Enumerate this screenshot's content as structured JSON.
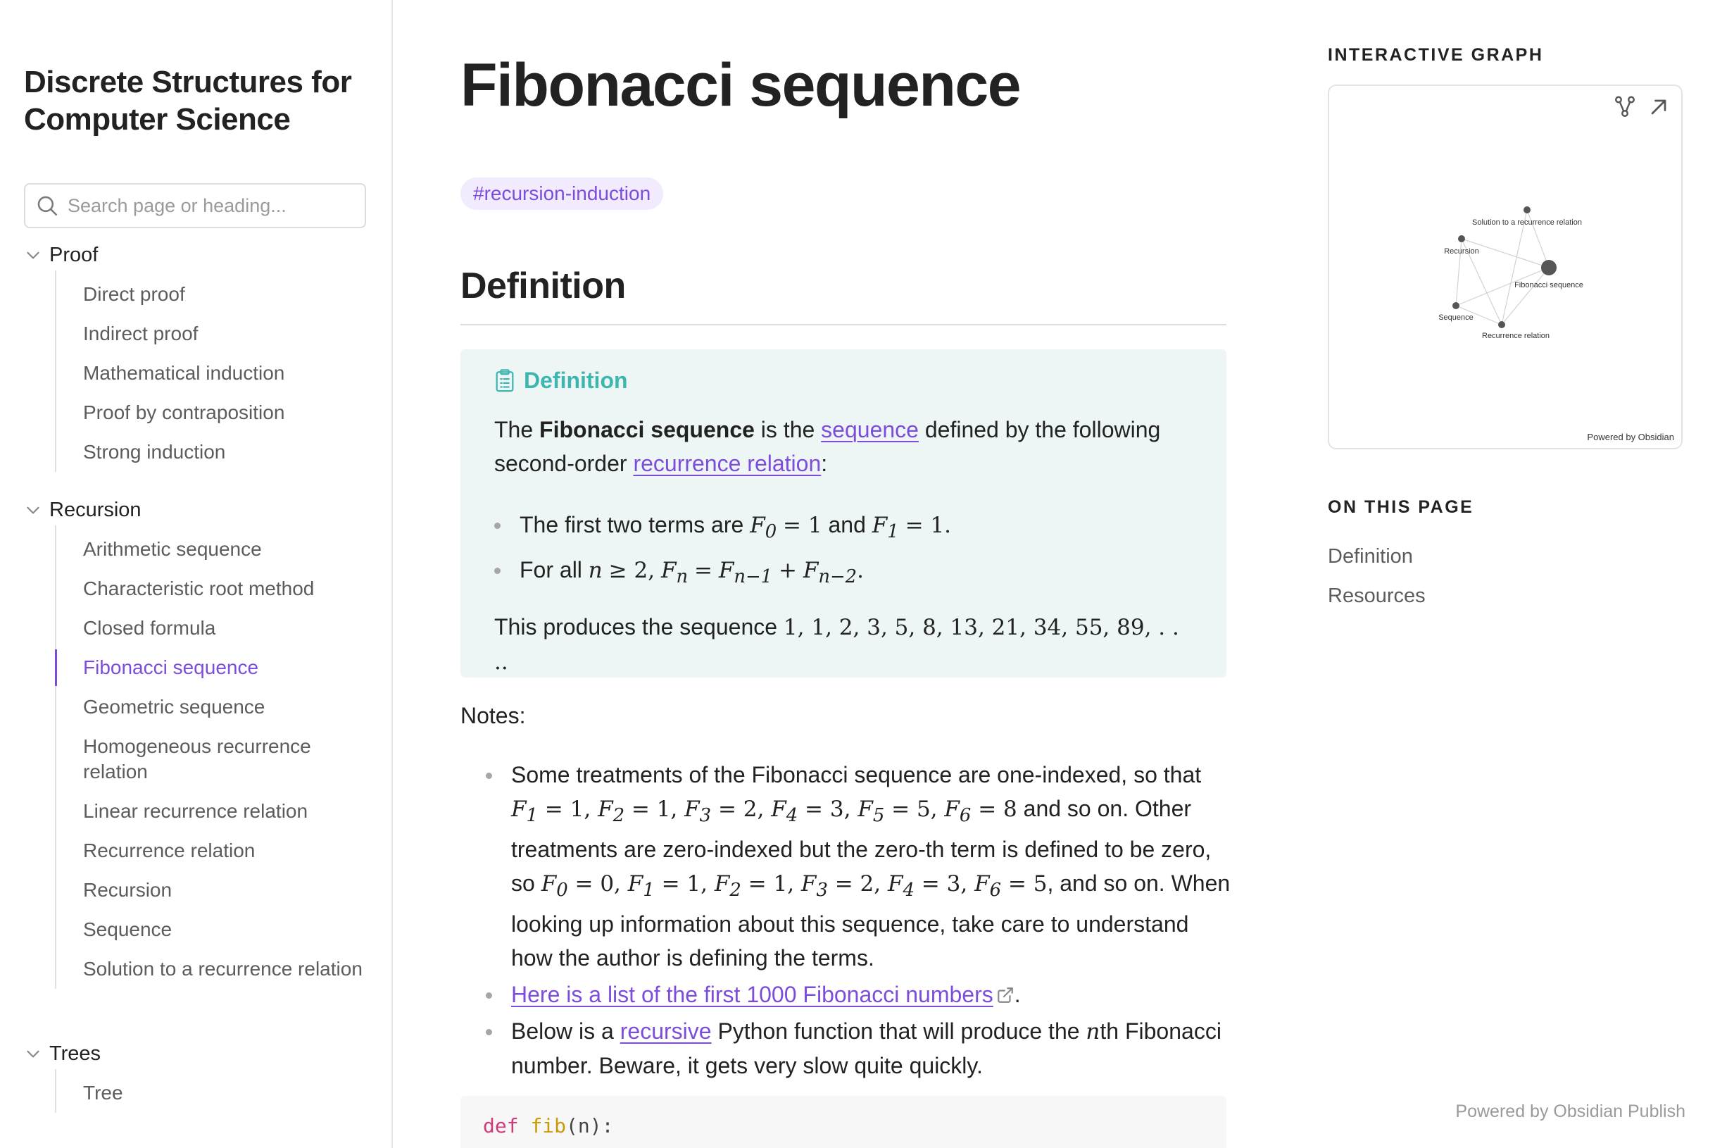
{
  "site": {
    "title": "Discrete Structures for Computer Science"
  },
  "search": {
    "placeholder": "Search page or heading..."
  },
  "nav": [
    {
      "label": "Proof",
      "items": [
        "Direct proof",
        "Indirect proof",
        "Mathematical induction",
        "Proof by contraposition",
        "Strong induction"
      ]
    },
    {
      "label": "Recursion",
      "items": [
        "Arithmetic sequence",
        "Characteristic root method",
        "Closed formula",
        "Fibonacci sequence",
        "Geometric sequence",
        "Homogeneous recurrence relation",
        "Linear recurrence relation",
        "Recurrence relation",
        "Recursion",
        "Sequence",
        "Solution to a recurrence relation"
      ]
    },
    {
      "label": "Trees",
      "items": [
        "Tree"
      ]
    }
  ],
  "active_nav_item": "Fibonacci sequence",
  "page": {
    "title": "Fibonacci sequence",
    "tag": "#recursion-induction",
    "section_heading": "Definition",
    "callout": {
      "title": "Definition",
      "p1_start": "The ",
      "p1_bold": "Fibonacci sequence",
      "p1_mid1": " is the ",
      "p1_link1": "sequence",
      "p1_mid2": " defined by the following second-order ",
      "p1_link2": "recurrence relation",
      "p1_end": ":",
      "bullet1_text": "The first two terms are",
      "bullet1_and": "and",
      "bullet2_text": "For all",
      "sequence_text": "This produces the sequence"
    },
    "notes_label": "Notes:",
    "note1_a": "Some treatments of the Fibonacci sequence are one-indexed, so that",
    "note1_b": "and so on. Other treatments are zero-indexed but the zero-th term is defined to be zero, so",
    "note1_c": ", and so on. When looking up information about this sequence, take care to understand how the author is defining the terms.",
    "note2_link": "Here is a list of the first 1000 Fibonacci numbers",
    "note2_end": ".",
    "note3_a": "Below is a ",
    "note3_link": "recursive",
    "note3_b": " Python function that will produce the",
    "note3_c": "th Fibonacci number. Beware, it gets very slow quite quickly.",
    "code_kw": "def",
    "code_fn": "fib",
    "code_rest": "(n):"
  },
  "right_panel": {
    "graph_label": "INTERACTIVE GRAPH",
    "graph_nodes": [
      "Solution to a recurrence relation",
      "Recursion",
      "Fibonacci sequence",
      "Sequence",
      "Recurrence relation"
    ],
    "graph_powered": "Powered by Obsidian",
    "toc_label": "ON THIS PAGE",
    "toc_items": [
      "Definition",
      "Resources"
    ]
  },
  "footer": {
    "powered": "Powered by Obsidian Publish"
  },
  "colors": {
    "accent": "#7c4ddb",
    "callout_bg": "#eef6f5",
    "callout_title": "#3db6b0",
    "tag_bg": "#f1ebfd"
  },
  "icons": {
    "search": "search-icon",
    "chevron": "chevron-down-icon",
    "callout": "clipboard-list-icon",
    "graph_global": "graph-icon",
    "graph_expand": "arrow-up-right-icon",
    "external_link": "external-link-icon"
  }
}
